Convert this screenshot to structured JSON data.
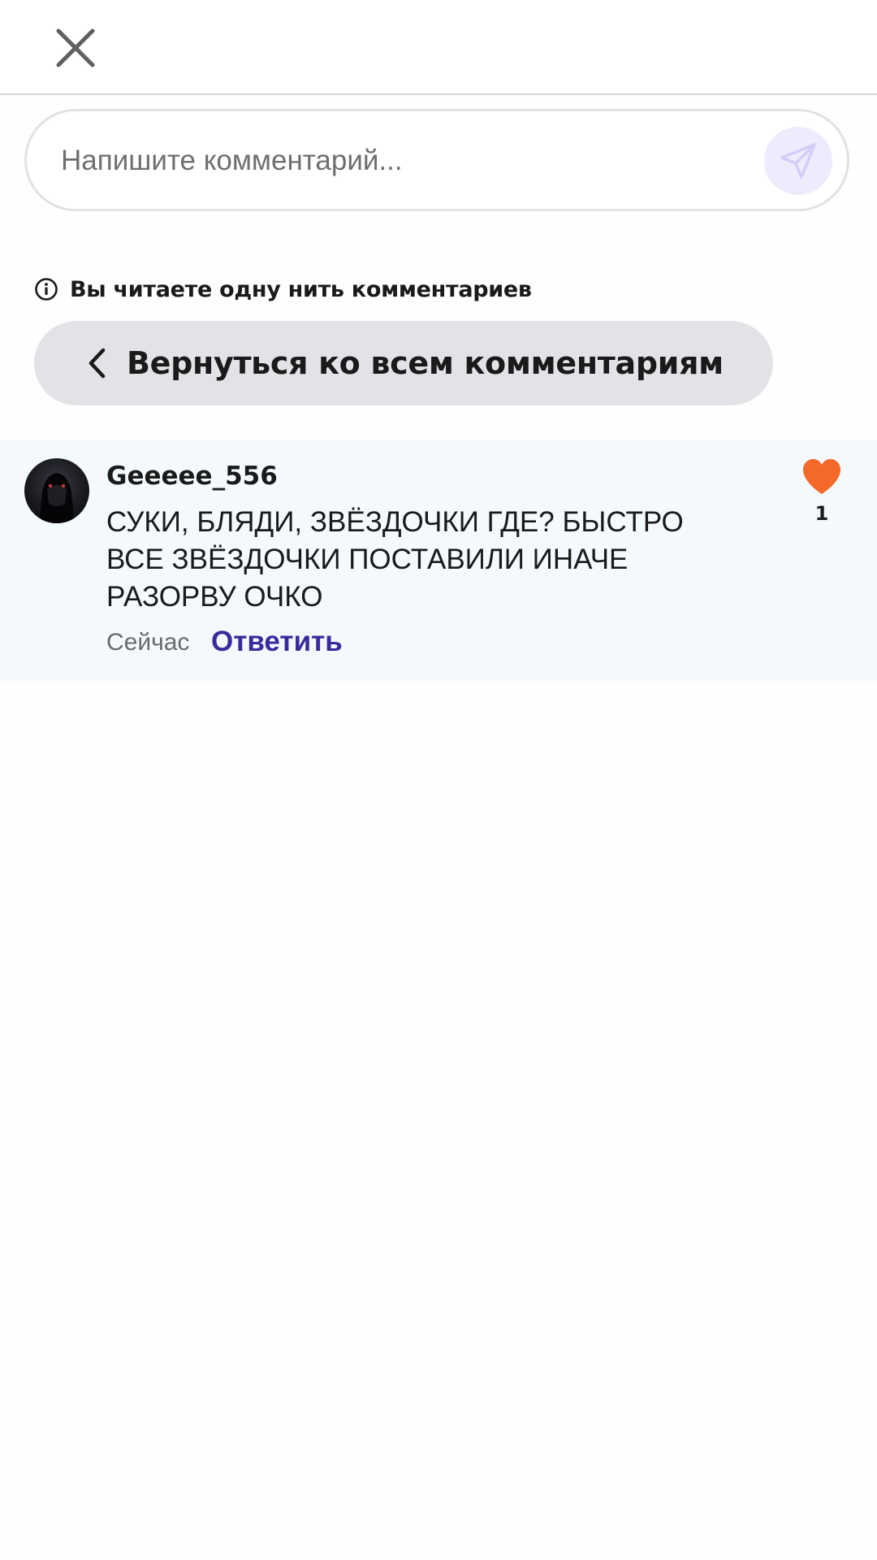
{
  "header": {
    "close_icon": "close-icon"
  },
  "comment_input": {
    "placeholder": "Напишите комментарий...",
    "value": "",
    "send_icon": "send-icon",
    "send_bg": "#eeebfc"
  },
  "thread": {
    "note": "Вы читаете одну нить комментариев",
    "back_label": "Вернуться ко всем комментариям"
  },
  "comments": [
    {
      "username": "Geeeee_556",
      "text": "СУКИ, БЛЯДИ, ЗВЁЗДОЧКИ ГДЕ? БЫСТРО ВСЕ ЗВЁЗДОЧКИ ПОСТАВИЛИ ИНАЧЕ РАЗОРВУ ОЧКО",
      "time": "Сейчас",
      "reply_label": "Ответить",
      "likes": "1",
      "like_color": "#f4692a"
    }
  ],
  "colors": {
    "accent": "#3a2a9c",
    "card_bg": "#f4f9fd",
    "back_button_bg": "#e4e2e6"
  }
}
